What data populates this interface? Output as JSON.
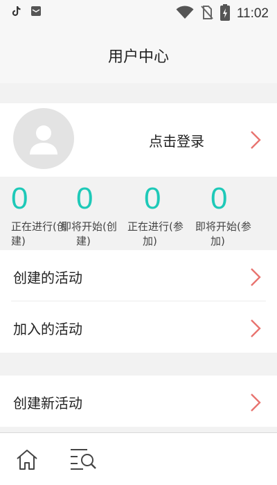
{
  "status_bar": {
    "time": "11:02",
    "left_icons": [
      "tiktok-icon",
      "email-icon"
    ],
    "right_icons": [
      "wifi-icon",
      "no-sim-icon",
      "battery-charging-icon"
    ]
  },
  "header": {
    "title": "用户中心"
  },
  "profile": {
    "login_label": "点击登录",
    "avatar_icon": "user-avatar-icon"
  },
  "stats": [
    {
      "value": "0",
      "label_line1": "正在进行(创",
      "label_line2": "建)"
    },
    {
      "value": "0",
      "label_line1": "即将开始(创",
      "label_line2": "建)"
    },
    {
      "value": "0",
      "label_line1": "正在进行(参",
      "label_line2": "加)"
    },
    {
      "value": "0",
      "label_line1": "即将开始(参",
      "label_line2": "加)"
    }
  ],
  "menu": {
    "created_activities": "创建的活动",
    "joined_activities": "加入的活动",
    "create_new_activity": "创建新活动"
  },
  "bottom_nav": {
    "items": [
      "home-icon",
      "search-list-icon"
    ]
  },
  "colors": {
    "accent": "#1ec9b8",
    "chevron": "#e8736f",
    "background": "#f2f2f2"
  }
}
